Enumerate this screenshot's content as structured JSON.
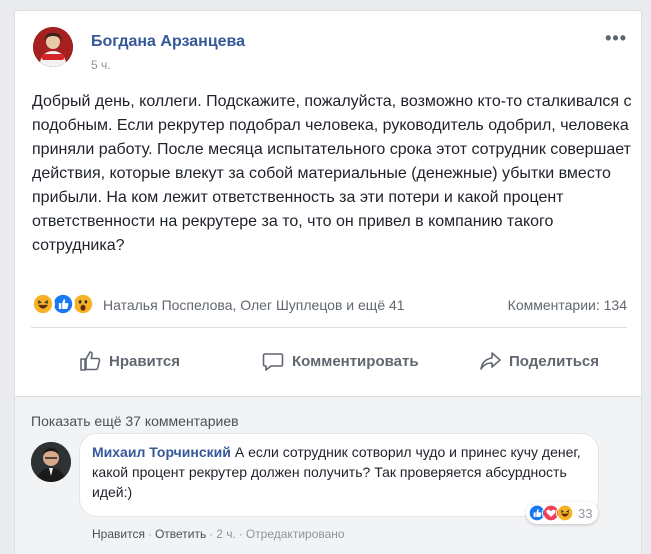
{
  "post": {
    "author": "Богдана Арзанцева",
    "time": "5 ч.",
    "more_label": "•••",
    "text": "Добрый день, коллеги. Подскажите, пожалуйста, возможно кто-то сталкивался с подобным. Если рекрутер подобрал человека, руководитель одобрил, человека приняли работу. После месяца испытательного срока этот сотрудник совершает действия, которые влекут за собой материальные (денежные) убытки вместо прибыли. На ком лежит ответственность за эти потери и какой процент ответственности на рекрутере за то, что он привел в компанию такого сотрудника?",
    "reactions": {
      "names": "Наталья Поспелова, Олег Шуплецов и ещё 41",
      "comments_count": "Комментарии: 134",
      "icons": [
        "haha-icon",
        "like-icon",
        "wow-icon"
      ]
    },
    "actions": {
      "like": "Нравится",
      "comment": "Комментировать",
      "share": "Поделиться"
    }
  },
  "comments_section": {
    "show_more": "Показать ещё 37 комментариев",
    "comment": {
      "author": "Михаил Торчинский",
      "text": "А если сотрудник сотворил чудо и принес кучу денег, какой процент рекрутер должен получить? Так проверяется абсурдность идей:)",
      "reaction_count": "33",
      "reaction_icons": [
        "like-icon",
        "love-icon",
        "haha-icon"
      ],
      "meta": {
        "like": "Нравится",
        "reply": "Ответить",
        "time": "2 ч.",
        "edited": "Отредактировано",
        "separator": "·"
      }
    }
  },
  "colors": {
    "link": "#365899",
    "like_blue": "#1877f2",
    "haha_yellow": "#f7b125",
    "love_red": "#f33e58"
  }
}
